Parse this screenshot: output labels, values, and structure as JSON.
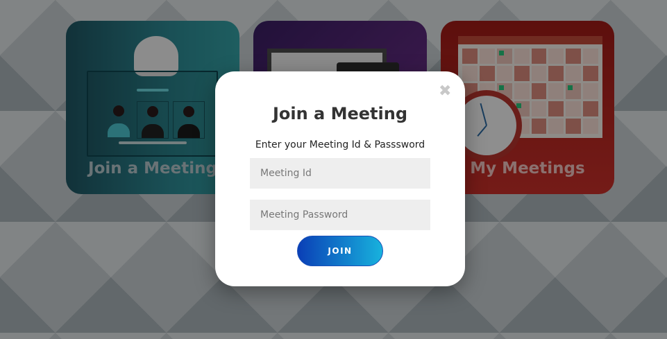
{
  "cards": [
    {
      "label": "Join a Meeting"
    },
    {
      "label": ""
    },
    {
      "label": "My Meetings"
    }
  ],
  "modal": {
    "close_icon": "close-icon",
    "close_glyph": "✖",
    "title": "Join a Meeting",
    "subtitle": "Enter your Meeting Id & Passsword",
    "meeting_id_placeholder": "Meeting Id",
    "meeting_password_placeholder": "Meeting Password",
    "join_label": "JOIN"
  },
  "colors": {
    "join_card": "#2d8a94",
    "mid_card": "#5e2a7d",
    "my_card": "#c9302a",
    "join_button_start": "#0a3fb6",
    "join_button_end": "#18b2dd"
  }
}
